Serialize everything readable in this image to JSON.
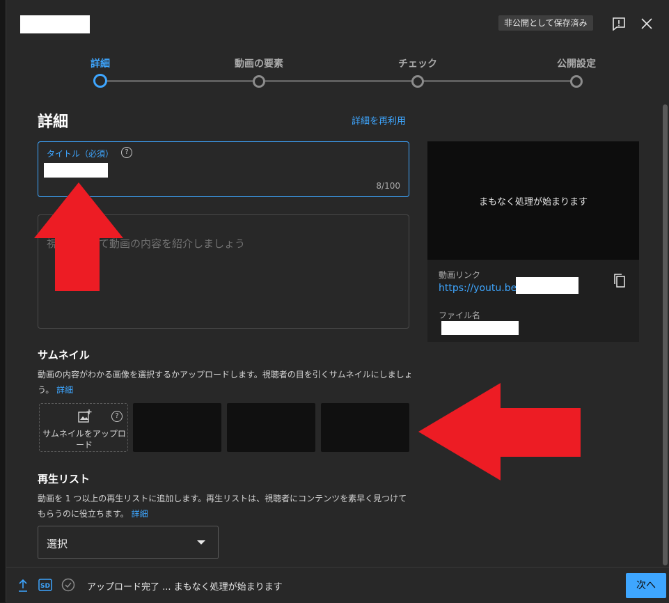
{
  "header": {
    "status_badge": "非公開として保存済み",
    "feedback_icon": "feedback-icon",
    "close_icon": "close-icon"
  },
  "stepper": {
    "steps": [
      {
        "label": "詳細",
        "active": true
      },
      {
        "label": "動画の要素",
        "active": false
      },
      {
        "label": "チェック",
        "active": false
      },
      {
        "label": "公開設定",
        "active": false
      }
    ]
  },
  "details": {
    "title": "詳細",
    "reuse_link": "詳細を再利用",
    "title_field": {
      "label": "タイトル（必須）",
      "char_count": "8/100"
    },
    "description_field": {
      "placeholder": "視聴者に向けて動画の内容を紹介しましょう",
      "visible_placeholder": "視　　　けて動画の内容を紹介しましょう"
    }
  },
  "preview": {
    "processing_text": "まもなく処理が始まります",
    "link_label": "動画リンク",
    "link_prefix": "https://youtu.be/",
    "filename_label": "ファイル名"
  },
  "thumbnail": {
    "heading": "サムネイル",
    "description": "動画の内容がわかる画像を選択するかアップロードします。視聴者の目を引くサムネイルにしましょう。",
    "details_link": "詳細",
    "upload_label": "サムネイルをアップロード"
  },
  "playlist": {
    "heading": "再生リスト",
    "description": "動画を 1 つ以上の再生リストに追加します。再生リストは、視聴者にコンテンツを素早く見つけてもらうのに役立ちます。",
    "details_link": "詳細",
    "select_value": "選択"
  },
  "footer": {
    "status": "アップロード完了 ... まもなく処理が始まります",
    "next_button": "次へ"
  },
  "colors": {
    "accent": "#3ea6ff",
    "annotation_arrow": "#ed1c24"
  }
}
